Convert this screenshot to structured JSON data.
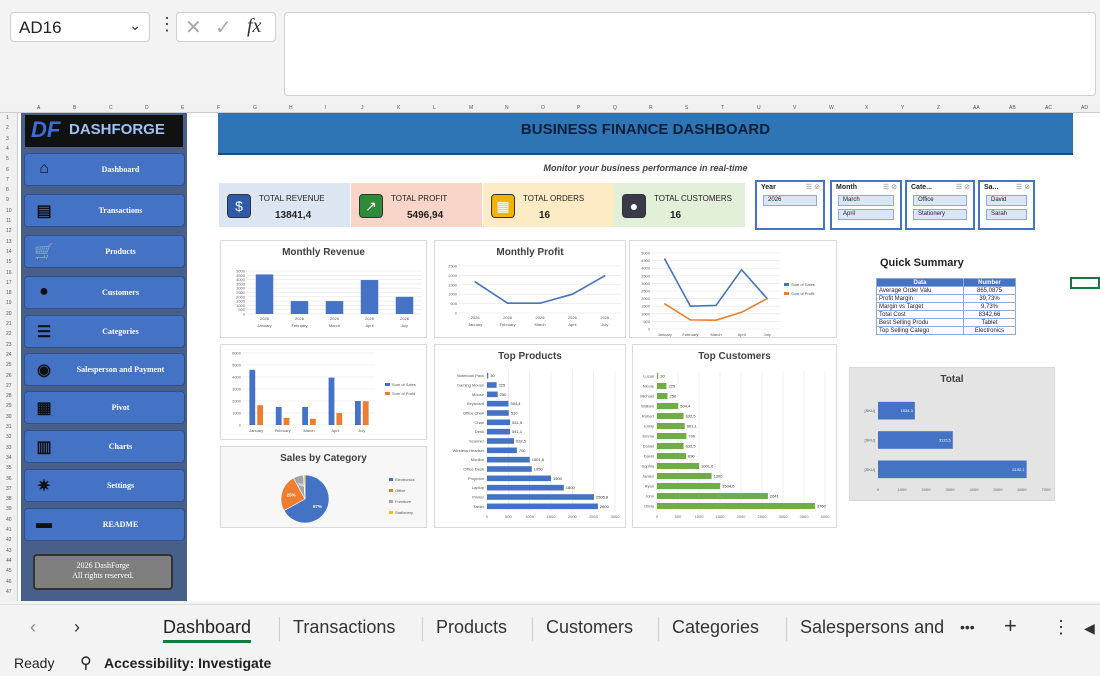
{
  "formula": {
    "name_box": "AD16",
    "fx_label": "fx"
  },
  "sidebar": {
    "logo": "DF",
    "brand": "DASHFORGE",
    "items": [
      {
        "label": "Dashboard",
        "icon": "home-icon"
      },
      {
        "label": "Transactions",
        "icon": "document-icon"
      },
      {
        "label": "Products",
        "icon": "cart-icon"
      },
      {
        "label": "Customers",
        "icon": "person-icon"
      },
      {
        "label": "Categories",
        "icon": "stack-icon"
      },
      {
        "label": "Salesperson and Payment",
        "icon": "coins-icon"
      },
      {
        "label": "Pivot",
        "icon": "grid-icon"
      },
      {
        "label": "Charts",
        "icon": "chart-icon"
      },
      {
        "label": "Settings",
        "icon": "gear-icon"
      },
      {
        "label": "README",
        "icon": "chat-icon"
      }
    ],
    "copyright_line1": "2026 DashForge",
    "copyright_line2": "All rights reserved."
  },
  "dashboard": {
    "title": "BUSINESS FINANCE DASHBOARD",
    "subtitle": "Monitor your business performance in real-time",
    "kpis": [
      {
        "label": "TOTAL REVENUE",
        "value": "13841,4",
        "bg": "#dce6f2",
        "icon_bg": "#2e5aa8",
        "icon": "$"
      },
      {
        "label": "TOTAL PROFIT",
        "value": "5496,94",
        "bg": "#f8d5c8",
        "icon_bg": "#2e8b3a",
        "icon": "↗"
      },
      {
        "label": "TOTAL ORDERS",
        "value": "16",
        "bg": "#fdebc6",
        "icon_bg": "#f0b400",
        "icon": "▦"
      },
      {
        "label": "TOTAL CUSTOMERS",
        "value": "16",
        "bg": "#e2efd9",
        "icon_bg": "#3a3a4a",
        "icon": "●"
      }
    ],
    "slicers": [
      {
        "header": "Year",
        "items": [
          "2026"
        ]
      },
      {
        "header": "Month",
        "items": [
          "March",
          "April"
        ]
      },
      {
        "header": "Cate...",
        "items": [
          "Office",
          "Stationery"
        ]
      },
      {
        "header": "Sa...",
        "items": [
          "David",
          "Sarah"
        ]
      }
    ]
  },
  "quick_summary": {
    "title": "Quick Summary",
    "headers": [
      "Data",
      "Number"
    ],
    "rows": [
      [
        "Average Order Valu",
        "865,0875"
      ],
      [
        "Profit Margin",
        "39,73%"
      ],
      [
        "Margin vs Target",
        "9,73%"
      ],
      [
        "Total Cost",
        "8342,66"
      ],
      [
        "Best Selling Produ",
        "Tablet"
      ],
      [
        "Top Selling Catego",
        "Electronics"
      ]
    ]
  },
  "chart_data": [
    {
      "id": "monthly-revenue",
      "type": "bar",
      "title": "Monthly Revenue",
      "categories": [
        "January",
        "February",
        "March",
        "April",
        "July"
      ],
      "values": [
        4600,
        1500,
        1500,
        3950,
        2000
      ],
      "ylim": [
        0,
        5000
      ],
      "yticks": [
        0,
        500,
        1000,
        1500,
        2000,
        2500,
        3000,
        3500,
        4000,
        4500,
        5000
      ],
      "xtop": [
        "2026",
        "2026",
        "2026",
        "2026",
        "2026"
      ],
      "color": "#4472c4"
    },
    {
      "id": "monthly-profit",
      "type": "line",
      "title": "Monthly Profit",
      "categories": [
        "January",
        "February",
        "March",
        "April",
        "July"
      ],
      "values": [
        1650,
        520,
        520,
        1000,
        1980
      ],
      "ylim": [
        0,
        2500
      ],
      "yticks": [
        0,
        500,
        1000,
        1500,
        2000,
        2500
      ],
      "xtop": [
        "2026",
        "2026",
        "2026",
        "2026",
        "2026"
      ],
      "color": "#4472c4"
    },
    {
      "id": "sales-vs-profit-line",
      "type": "line",
      "title": "",
      "categories": [
        "January",
        "February",
        "March",
        "April",
        "July"
      ],
      "series": [
        {
          "name": "Sum of Sales",
          "values": [
            4600,
            1500,
            1550,
            3900,
            2000
          ],
          "color": "#4472c4"
        },
        {
          "name": "Sum of Profit",
          "values": [
            1650,
            600,
            580,
            1100,
            2000
          ],
          "color": "#ed7d31"
        }
      ],
      "ylim": [
        0,
        5000
      ],
      "yticks": [
        0,
        500,
        1000,
        1500,
        2000,
        2500,
        3000,
        3500,
        4000,
        4500,
        5000
      ]
    },
    {
      "id": "sales-vs-profit-bar",
      "type": "bar",
      "title": "",
      "categories": [
        "January",
        "February",
        "March",
        "April",
        "July"
      ],
      "series": [
        {
          "name": "Sum of Sales",
          "values": [
            4600,
            1500,
            1500,
            3950,
            2000
          ],
          "color": "#4472c4"
        },
        {
          "name": "Sum of Profit",
          "values": [
            1650,
            600,
            520,
            1000,
            1980
          ],
          "color": "#ed7d31"
        }
      ],
      "ylim": [
        0,
        6000
      ],
      "yticks": [
        0,
        1000,
        2000,
        3000,
        4000,
        5000,
        6000
      ]
    },
    {
      "id": "sales-by-category",
      "type": "pie",
      "title": "Sales by Category",
      "slices": [
        {
          "name": "Electronics",
          "value": 67,
          "color": "#4472c4"
        },
        {
          "name": "Office",
          "value": 25,
          "color": "#ed7d31"
        },
        {
          "name": "Furniture",
          "value": 7,
          "color": "#a5a5a5"
        },
        {
          "name": "Stationery",
          "value": 1,
          "color": "#ffc000"
        }
      ],
      "labels": [
        "67%",
        "25%",
        "7%",
        ""
      ]
    },
    {
      "id": "top-products",
      "type": "bar",
      "title": "Top Products",
      "orientation": "horizontal",
      "categories": [
        "Notebook Pack",
        "Gaming Mouse",
        "Mouse",
        "Keyboard",
        "Office Chair",
        "Chair",
        "Desk",
        "Scanner",
        "Wireless Headset",
        "Monitor",
        "Office Desk",
        "Projector",
        "Laptop",
        "Printer",
        "Tablet"
      ],
      "values": [
        30,
        225,
        250,
        504.4,
        510,
        541.5,
        541.1,
        632.5,
        700,
        1001.6,
        1050,
        1500,
        1800,
        2505.8,
        2600
      ],
      "value_labels": [
        "30",
        "225",
        "250",
        "504,4",
        "510",
        "541,5",
        "541,1",
        "632,5",
        "700",
        "1001,6",
        "1050",
        "1500",
        "1800",
        "2505,8",
        "2600"
      ],
      "xlim": [
        0,
        3000
      ],
      "xticks": [
        0,
        500,
        1000,
        1500,
        2000,
        2500,
        3000
      ],
      "color": "#4472c4"
    },
    {
      "id": "top-customers",
      "type": "bar",
      "title": "Top Customers",
      "orientation": "horizontal",
      "categories": [
        "Lucas",
        "Nicole",
        "Michael",
        "William",
        "Robert",
        "Emily",
        "Emma",
        "Daniel",
        "David",
        "Sophia",
        "James",
        "Ryan",
        "John",
        "Olivia"
      ],
      "values": [
        30,
        225,
        250,
        504.4,
        632.5,
        661.1,
        700,
        632.5,
        690,
        1001.6,
        1300,
        1504.6,
        2641,
        3760
      ],
      "value_labels": [
        "30",
        "225",
        "250",
        "504,4",
        "632,5",
        "661,1",
        "700",
        "632,5",
        "690",
        "1001,6",
        "1300",
        "1504,6",
        "2641",
        "3760"
      ],
      "xlim": [
        0,
        4000
      ],
      "xticks": [
        0,
        500,
        1000,
        1500,
        2000,
        2500,
        3000,
        3500,
        4000
      ],
      "color": "#70ad47"
    },
    {
      "id": "total-by-year",
      "type": "bar",
      "title": "Total",
      "orientation": "horizontal",
      "categories": [
        "[SKU]",
        "[SKU]",
        "[SKU]"
      ],
      "values": [
        1534.3,
        3115.5,
        6192.1
      ],
      "value_labels": [
        "1534,3",
        "3115,5",
        "6192,1"
      ],
      "xlim": [
        0,
        7000
      ],
      "xticks": [
        0,
        1000,
        2000,
        3000,
        4000,
        5000,
        6000,
        7000
      ],
      "color": "#4472c4"
    }
  ],
  "tabs": [
    "Dashboard",
    "Transactions",
    "Products",
    "Customers",
    "Categories",
    "Salespersons and"
  ],
  "status": {
    "ready": "Ready",
    "accessibility": "Accessibility: Investigate"
  }
}
